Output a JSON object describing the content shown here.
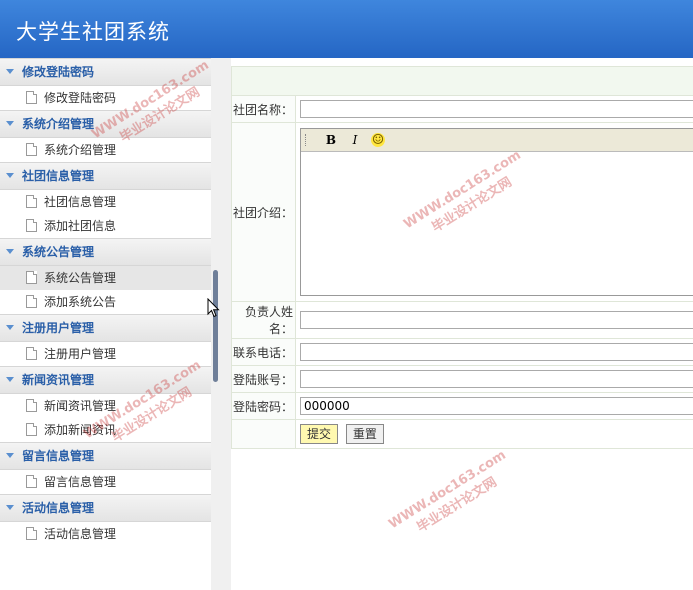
{
  "header": {
    "title": "大学生社团系统"
  },
  "sidebar": {
    "groups": [
      {
        "title": "修改登陆密码",
        "items": [
          "修改登陆密码"
        ]
      },
      {
        "title": "系统介绍管理",
        "items": [
          "系统介绍管理"
        ]
      },
      {
        "title": "社团信息管理",
        "items": [
          "社团信息管理",
          "添加社团信息"
        ]
      },
      {
        "title": "系统公告管理",
        "items": [
          "系统公告管理",
          "添加系统公告"
        ]
      },
      {
        "title": "注册用户管理",
        "items": [
          "注册用户管理"
        ]
      },
      {
        "title": "新闻资讯管理",
        "items": [
          "新闻资讯管理",
          "添加新闻资讯"
        ]
      },
      {
        "title": "留言信息管理",
        "items": [
          "留言信息管理"
        ]
      },
      {
        "title": "活动信息管理",
        "items": [
          "活动信息管理"
        ]
      }
    ],
    "active_item": "系统公告管理"
  },
  "form": {
    "club_name_label": "社团名称：",
    "club_name_value": "",
    "club_intro_label": "社团介绍：",
    "editor_tools": {
      "bold": "B",
      "italic": "I",
      "emoji": "☺"
    },
    "leader_label": "负责人姓名：",
    "leader_value": "",
    "phone_label": "联系电话：",
    "phone_value": "",
    "account_label": "登陆账号：",
    "account_value": "",
    "password_label": "登陆密码：",
    "password_value": "000000",
    "submit_label": "提交",
    "reset_label": "重置"
  },
  "watermark": {
    "line1": "毕业设计论文网",
    "line2": "WWW.doc163.com"
  },
  "colors": {
    "header": "#2f74d0",
    "group_title": "#2a5fa8",
    "submit_bg": "#fff9b0"
  }
}
